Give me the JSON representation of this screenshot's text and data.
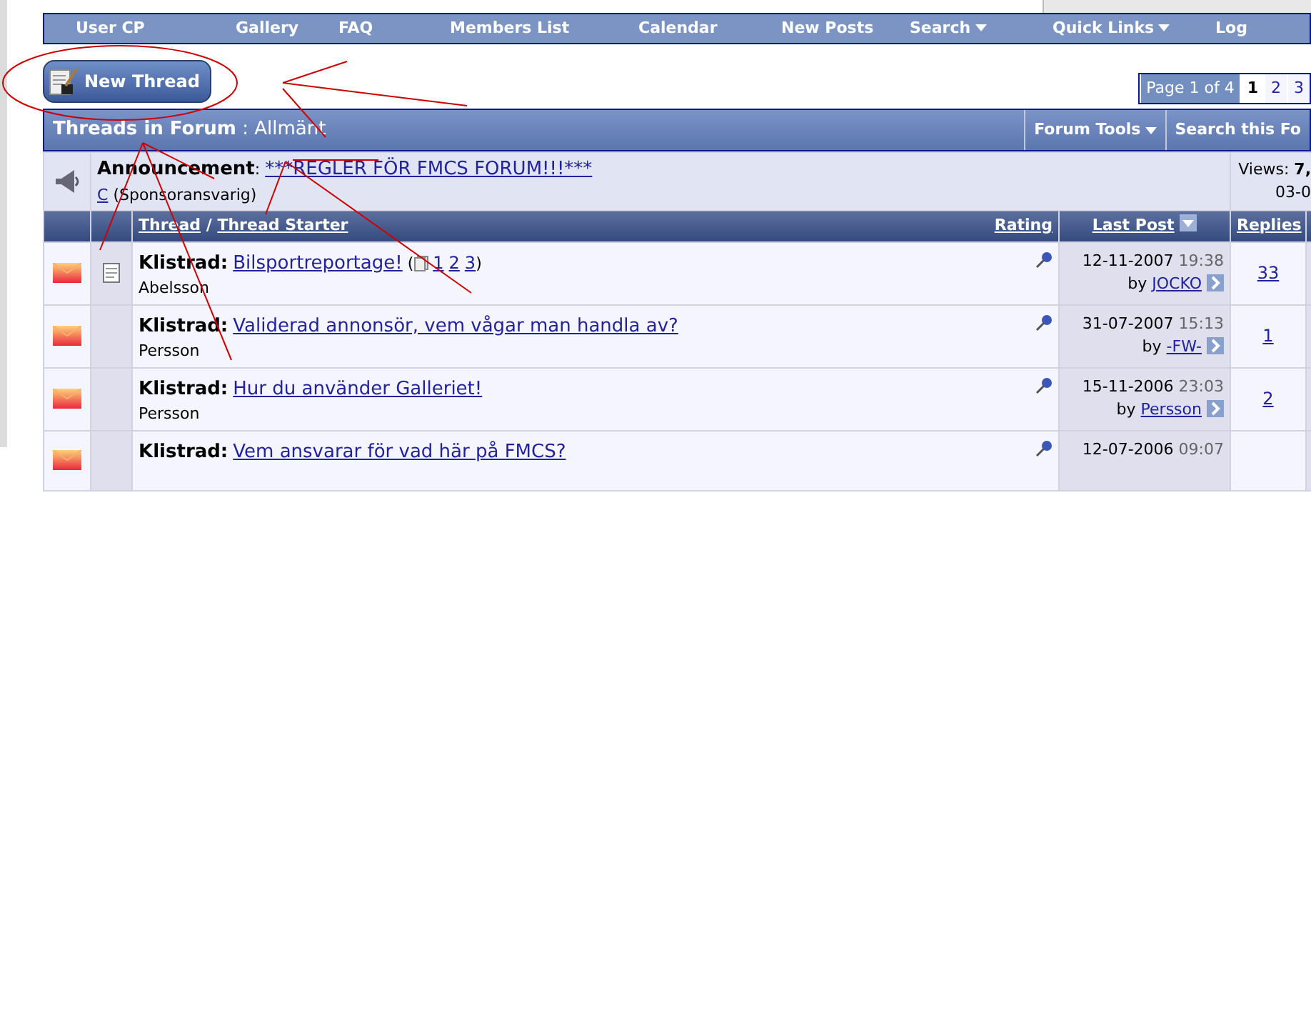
{
  "nav": [
    {
      "label": "User CP",
      "dropdown": false
    },
    {
      "label": "Gallery",
      "dropdown": false
    },
    {
      "label": "FAQ",
      "dropdown": false
    },
    {
      "label": "Members List",
      "dropdown": false
    },
    {
      "label": "Calendar",
      "dropdown": false
    },
    {
      "label": "New Posts",
      "dropdown": false
    },
    {
      "label": "Search",
      "dropdown": true
    },
    {
      "label": "Quick Links",
      "dropdown": true
    },
    {
      "label": "Log",
      "dropdown": false
    }
  ],
  "new_thread_button": "New Thread",
  "pagination": {
    "label": "Page 1 of 4",
    "pages": [
      {
        "label": "1",
        "selected": true
      },
      {
        "label": "2",
        "selected": false
      },
      {
        "label": "3",
        "selected": false
      }
    ]
  },
  "forum_bar": {
    "title": "Threads in Forum",
    "separator": ":",
    "forum": "Allmänt",
    "tools": [
      {
        "label": "Forum Tools",
        "dropdown": true
      },
      {
        "label": "Search this Fo",
        "dropdown": false
      }
    ]
  },
  "announcement": {
    "label": "Announcement",
    "colon": ":",
    "title": "***REGLER FÖR FMCS FORUM!!!***",
    "author": "C",
    "role": "(Sponsoransvarig)",
    "views_label": "Views:",
    "views": "7,",
    "date": "03-0"
  },
  "columns": {
    "thread": "Thread",
    "slash": "/",
    "starter": "Thread Starter",
    "rating": "Rating",
    "last_post": "Last Post",
    "replies": "Replies"
  },
  "threads": [
    {
      "prefix": "Klistrad:",
      "title": "Bilsportreportage!",
      "pages": {
        "open": "(",
        "links": [
          "1",
          "2",
          "3"
        ],
        "close": ")"
      },
      "starter": "Abelsson",
      "post_icon": true,
      "date": "12-11-2007",
      "time": "19:38",
      "by": "by",
      "last_poster": "JOCKO",
      "replies": "33"
    },
    {
      "prefix": "Klistrad:",
      "title": "Validerad annonsör, vem vågar man handla av?",
      "starter": "Persson",
      "post_icon": false,
      "date": "31-07-2007",
      "time": "15:13",
      "by": "by",
      "last_poster": "-FW-",
      "replies": "1"
    },
    {
      "prefix": "Klistrad:",
      "title": "Hur du använder Galleriet!",
      "starter": "Persson",
      "post_icon": false,
      "date": "15-11-2006",
      "time": "23:03",
      "by": "by",
      "last_poster": "Persson",
      "replies": "2"
    },
    {
      "prefix": "Klistrad:",
      "title": "Vem ansvarar för vad här på FMCS?",
      "post_icon": false,
      "date": "12-07-2006",
      "time": "09:07"
    }
  ]
}
